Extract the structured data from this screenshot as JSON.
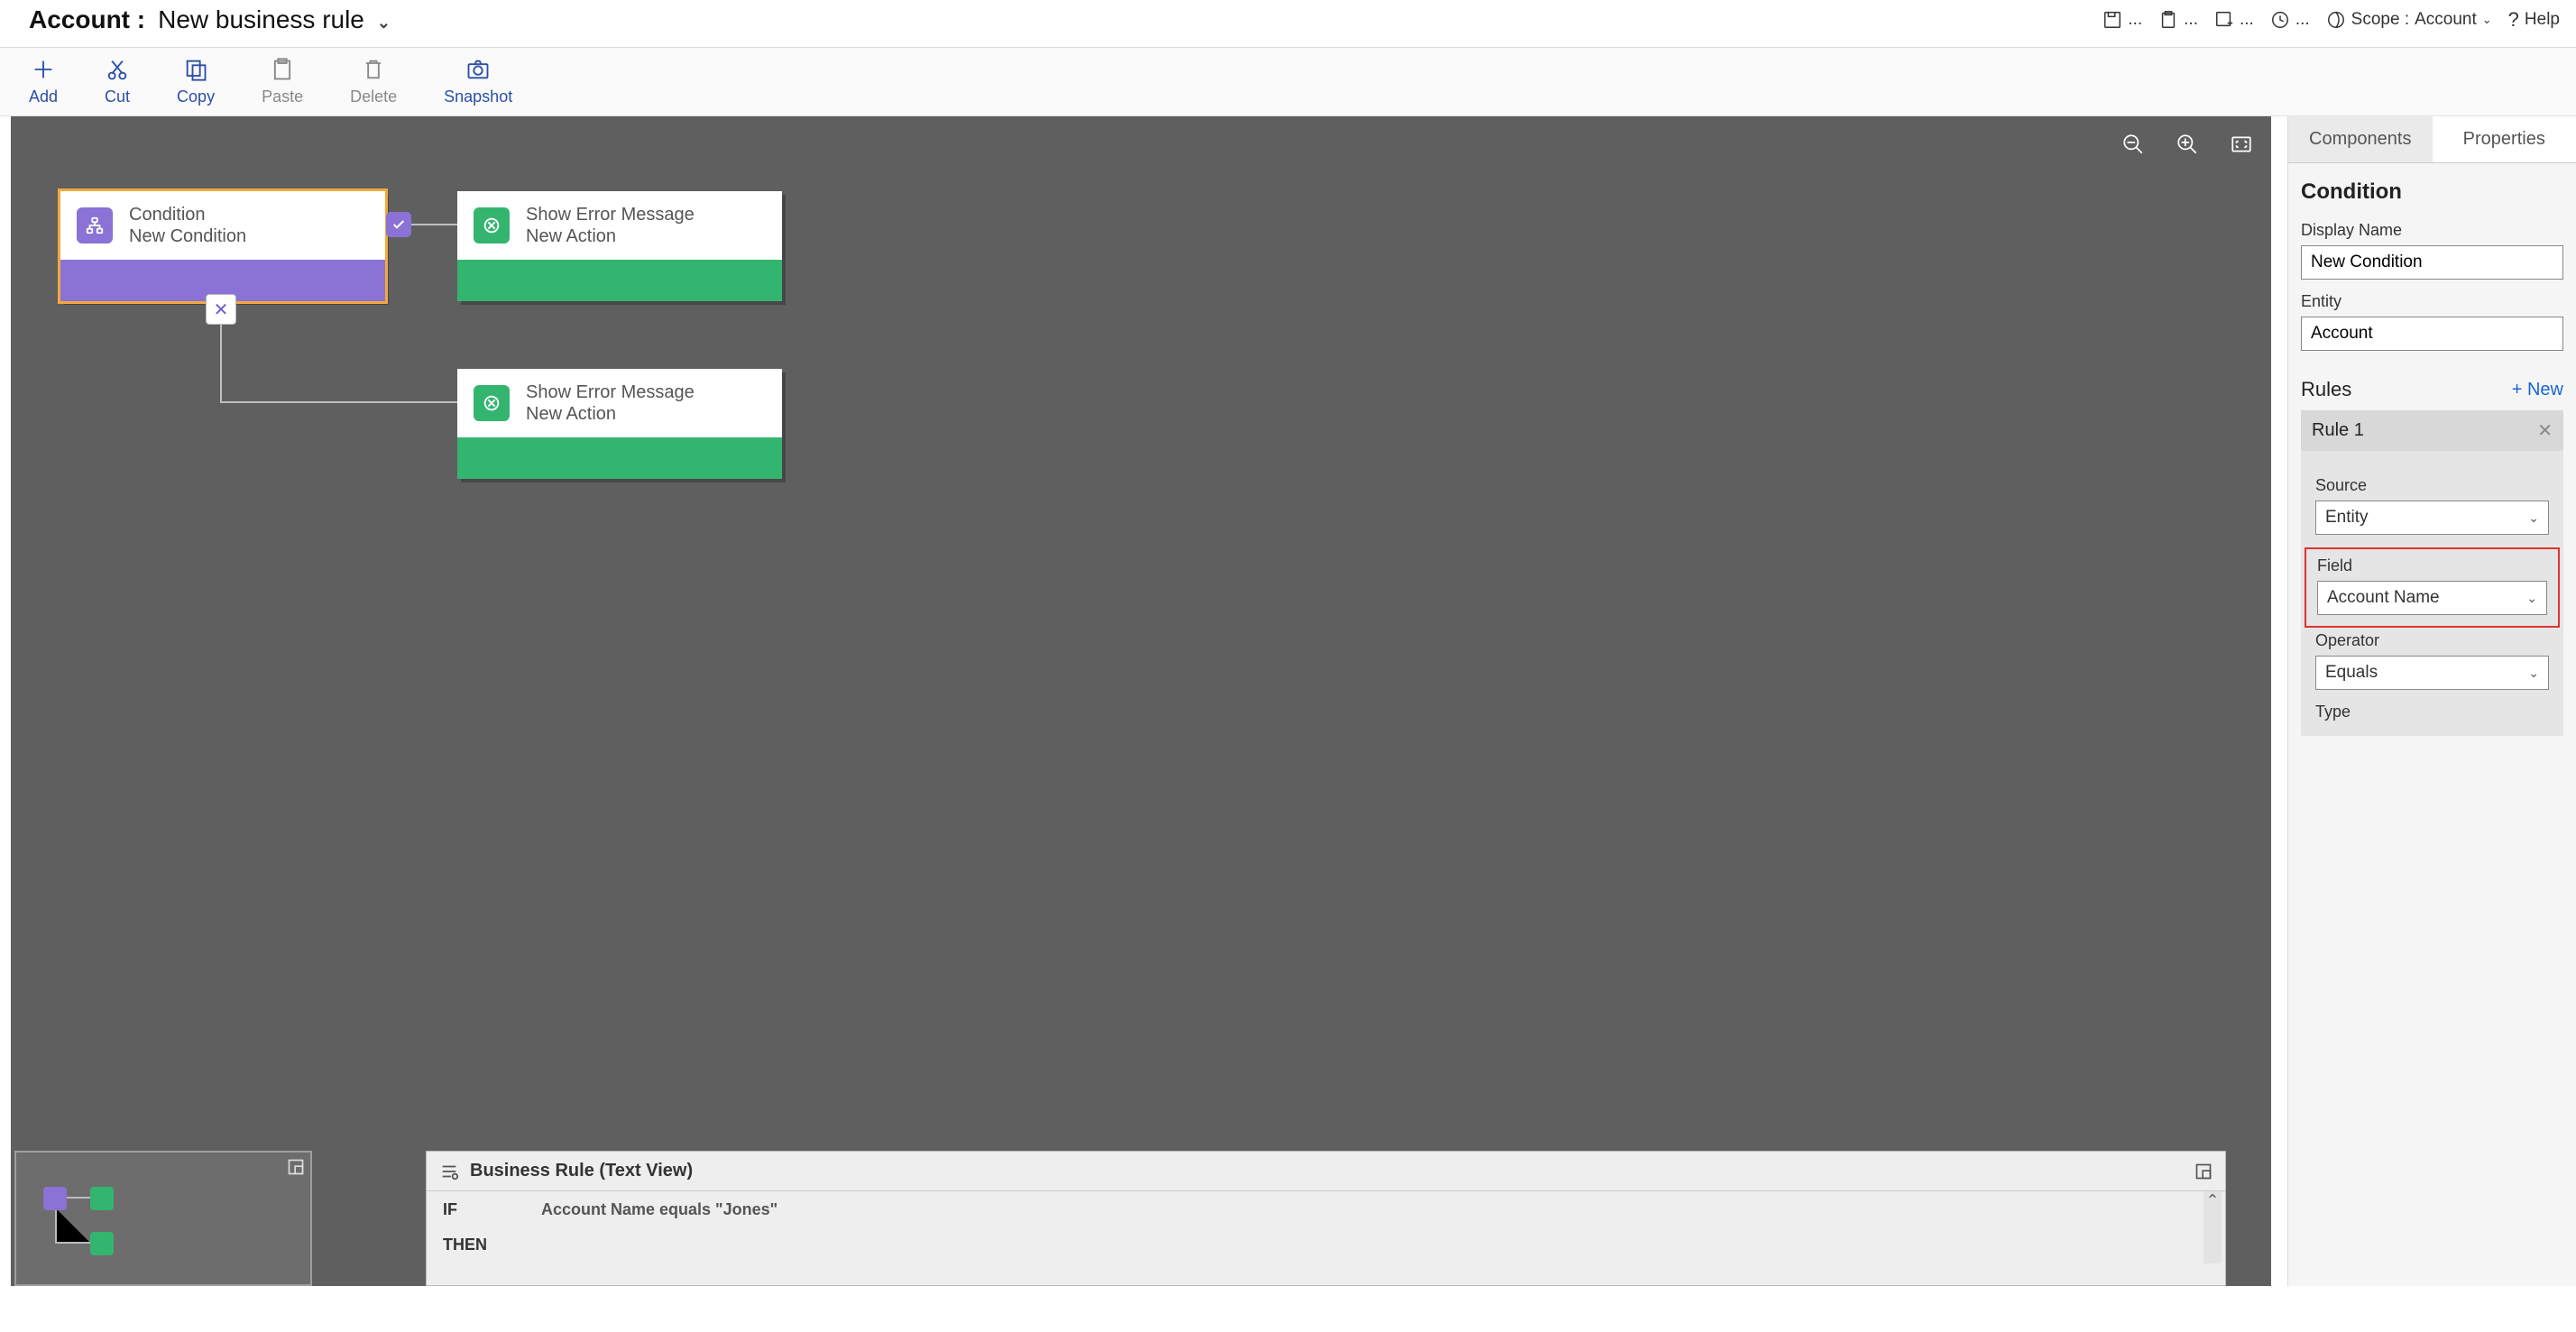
{
  "header": {
    "entity_prefix": "Account :",
    "rule_name": "New business rule",
    "scope_label": "Scope :",
    "scope_value": "Account",
    "help_label": "Help"
  },
  "toolbar": {
    "add": "Add",
    "cut": "Cut",
    "copy": "Copy",
    "paste": "Paste",
    "delete": "Delete",
    "snapshot": "Snapshot"
  },
  "canvas": {
    "condition_title": "Condition",
    "condition_sub": "New Condition",
    "action_title": "Show Error Message",
    "action_sub": "New Action"
  },
  "textview": {
    "title": "Business Rule (Text View)",
    "if_kw": "IF",
    "then_kw": "THEN",
    "if_text": "Account Name equals \"Jones\""
  },
  "properties": {
    "tab_components": "Components",
    "tab_properties": "Properties",
    "section_title": "Condition",
    "display_name_label": "Display Name",
    "display_name_value": "New Condition",
    "entity_label": "Entity",
    "entity_value": "Account",
    "rules_label": "Rules",
    "new_label": "+  New",
    "rule1_label": "Rule 1",
    "source_label": "Source",
    "source_value": "Entity",
    "field_label": "Field",
    "field_value": "Account Name",
    "operator_label": "Operator",
    "operator_value": "Equals",
    "type_label": "Type"
  }
}
